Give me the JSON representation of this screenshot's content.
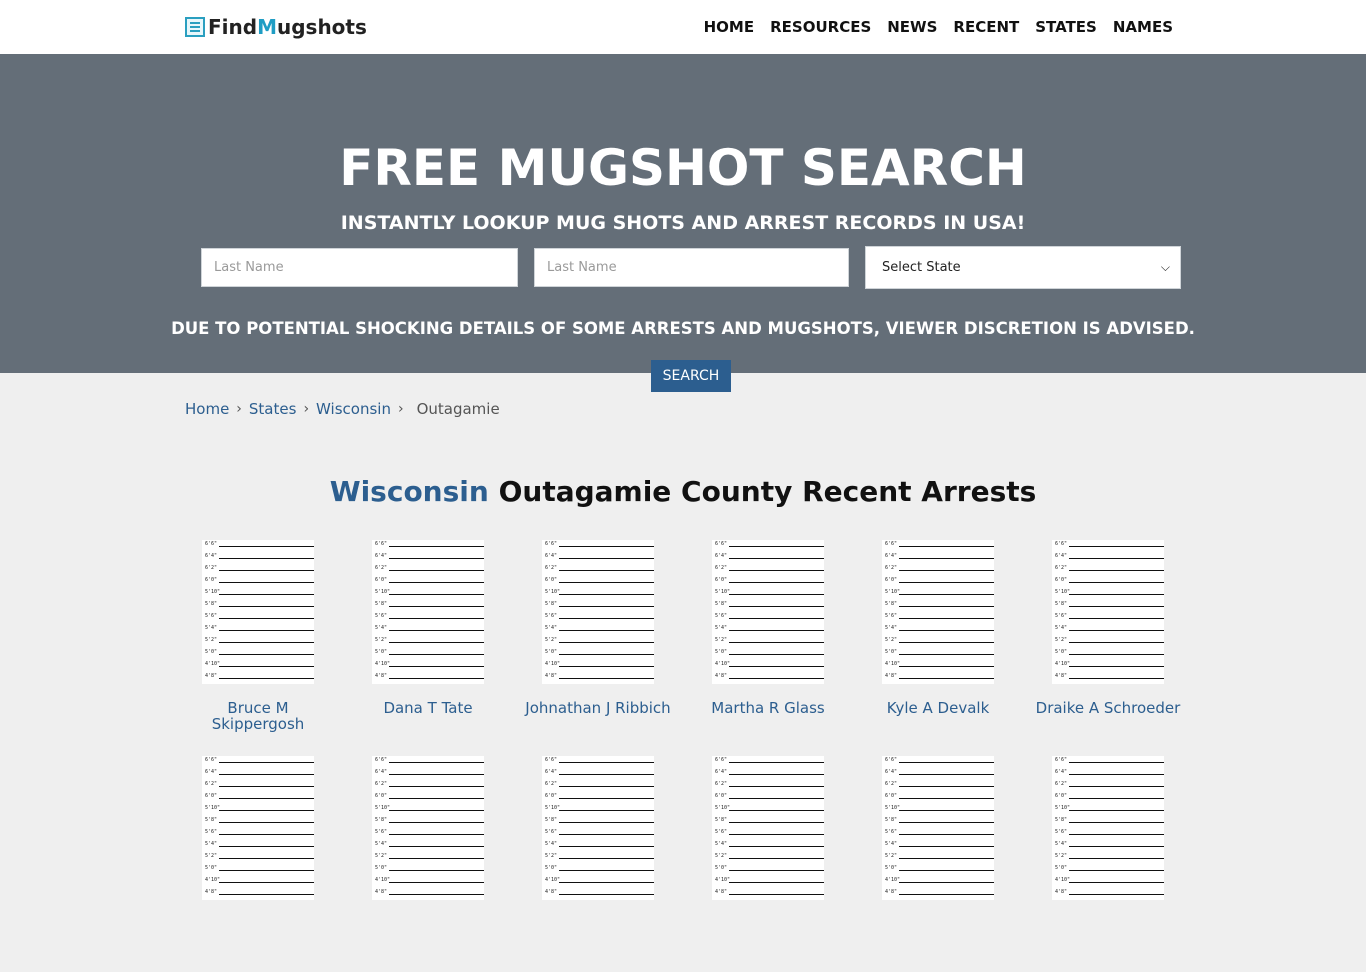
{
  "header": {
    "logo_part1": "Find",
    "logo_part2": "M",
    "logo_part3": "ugshots",
    "nav": [
      "HOME",
      "RESOURCES",
      "NEWS",
      "RECENT",
      "STATES",
      "NAMES"
    ]
  },
  "hero": {
    "title": "FREE MUGSHOT SEARCH",
    "subtitle": "INSTANTLY LOOKUP MUG SHOTS AND ARREST RECORDS IN USA!",
    "input1_placeholder": "Last Name",
    "input2_placeholder": "Last Name",
    "state_select": "Select State",
    "notice": "DUE TO POTENTIAL SHOCKING DETAILS OF SOME ARRESTS AND MUGSHOTS, VIEWER DISCRETION IS ADVISED.",
    "search_label": "SEARCH"
  },
  "breadcrumb": {
    "home": "Home",
    "states": "States",
    "state": "Wisconsin",
    "current": "Outagamie"
  },
  "heading": {
    "state": "Wisconsin",
    "rest": "Outagamie County Recent Arrests"
  },
  "height_chart_labels": [
    "6'6\"",
    "6'4\"",
    "6'2\"",
    "6'0\"",
    "5'10\"",
    "5'8\"",
    "5'6\"",
    "5'4\"",
    "5'2\"",
    "5'0\"",
    "4'10\"",
    "4'8\""
  ],
  "arrests": [
    {
      "name": "Bruce M Skippergosh"
    },
    {
      "name": "Dana T Tate"
    },
    {
      "name": "Johnathan J Ribbich"
    },
    {
      "name": "Martha R Glass"
    },
    {
      "name": "Kyle A Devalk"
    },
    {
      "name": "Draike A Schroeder"
    },
    {
      "name": ""
    },
    {
      "name": ""
    },
    {
      "name": ""
    },
    {
      "name": ""
    },
    {
      "name": ""
    },
    {
      "name": ""
    }
  ],
  "colors": {
    "hero_bg": "#646e78",
    "accent": "#2c5e8f",
    "logo_accent": "#1f9dc4"
  }
}
